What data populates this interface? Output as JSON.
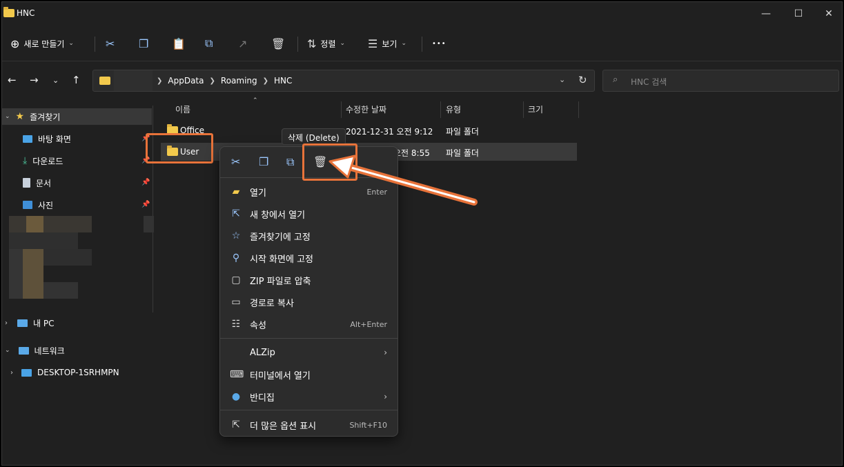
{
  "window": {
    "title": "HNC"
  },
  "toolbar": {
    "new_label": "새로 만들기",
    "sort_label": "정렬",
    "view_label": "보기",
    "more_label": "•••"
  },
  "nav": {
    "breadcrumbs": [
      "AppData",
      "Roaming",
      "HNC"
    ],
    "search_placeholder": "HNC 검색"
  },
  "sidebar": {
    "quick_access": "즐겨찾기",
    "items": [
      "바탕 화면",
      "다운로드",
      "문서",
      "사진"
    ],
    "this_pc": "내 PC",
    "network": "네트워크",
    "computer": "DESKTOP-1SRHMPN"
  },
  "columns": {
    "name": "이름",
    "date": "수정한 날짜",
    "type": "유형",
    "size": "크기"
  },
  "files": [
    {
      "name": "Office",
      "date": "2021-12-31 오전 9:12",
      "type": "파일 폴더"
    },
    {
      "name": "User",
      "date": "오전 8:55",
      "type": "파일 폴더"
    }
  ],
  "tooltip": "삭제 (Delete)",
  "context_menu": {
    "items": [
      {
        "label": "열기",
        "shortcut": "Enter",
        "icon": "folder-open-icon"
      },
      {
        "label": "새 창에서 열기",
        "icon": "new-window-icon"
      },
      {
        "label": "즐겨찾기에 고정",
        "icon": "star-icon"
      },
      {
        "label": "시작 화면에 고정",
        "icon": "pin-icon"
      },
      {
        "label": "ZIP 파일로 압축",
        "icon": "zip-icon"
      },
      {
        "label": "경로로 복사",
        "icon": "copy-path-icon"
      },
      {
        "label": "속성",
        "shortcut": "Alt+Enter",
        "icon": "properties-icon"
      }
    ],
    "items2": [
      {
        "label": "ALZip",
        "icon": "",
        "has_submenu": true
      },
      {
        "label": "터미널에서 열기",
        "icon": "terminal-icon"
      },
      {
        "label": "반디집",
        "icon": "bandizip-icon",
        "has_submenu": true
      }
    ],
    "more": {
      "label": "더 많은 옵션 표시",
      "shortcut": "Shift+F10"
    }
  },
  "accent": "#e8733a"
}
